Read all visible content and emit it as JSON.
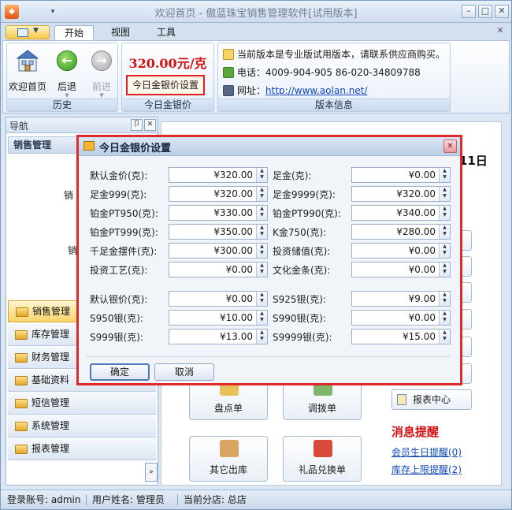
{
  "window": {
    "title": "欢迎首页 - 傲蓝珠宝销售管理软件[试用版本]",
    "minimize": "–",
    "maximize": "□",
    "close": "✕",
    "qa_arrow": "▾"
  },
  "ribbon_tabs": [
    {
      "label": "开始"
    },
    {
      "label": "视图"
    },
    {
      "label": "工具"
    }
  ],
  "ribbon": {
    "history_group": {
      "label": "历史",
      "buttons": [
        {
          "label": "欢迎首页"
        },
        {
          "label": "后退"
        },
        {
          "label": "前进"
        }
      ]
    },
    "price_group": {
      "label": "今日金银价",
      "price": "320.00元/克",
      "set_button": "今日金银价设置"
    },
    "info_group": {
      "label": "版本信息",
      "notice": "当前版本是专业版试用版本，请联系供应商购买。",
      "phone_label": "电话：",
      "phone": "4009-904-905  86-020-34809788",
      "site_label": "网址：",
      "site": "http://www.aolan.net/"
    }
  },
  "nav": {
    "title": "导航",
    "pin": "卩",
    "close": "✕",
    "section_title": "销售管理",
    "clip1": "销",
    "clip2": "销",
    "items": [
      {
        "label": "销售管理"
      },
      {
        "label": "库存管理"
      },
      {
        "label": "财务管理"
      },
      {
        "label": "基础资料"
      },
      {
        "label": "短信管理"
      },
      {
        "label": "系统管理"
      },
      {
        "label": "报表管理"
      }
    ],
    "expand": "»"
  },
  "main": {
    "date_fragment": "11日",
    "tiles": [
      {
        "label": "盘点单"
      },
      {
        "label": "调拨单"
      },
      {
        "label": "其它出库"
      },
      {
        "label": "礼品兑换单"
      }
    ],
    "report_button": "报表中心",
    "message_title": "消息提醒",
    "links": [
      {
        "label": "会员生日提醒(0)"
      },
      {
        "label": "库存上限提醒(2)"
      }
    ]
  },
  "status": {
    "account": "登录账号: admin",
    "username": "用户姓名: 管理员",
    "branch": "当前分店: 总店"
  },
  "dialog": {
    "title": "今日金银价设置",
    "fields_left": [
      {
        "label": "默认金价(克):",
        "value": "¥320.00"
      },
      {
        "label": "足金999(克):",
        "value": "¥320.00"
      },
      {
        "label": "铂金PT950(克):",
        "value": "¥330.00"
      },
      {
        "label": "铂金PT999(克):",
        "value": "¥350.00"
      },
      {
        "label": "千足金摆件(克):",
        "value": "¥300.00"
      },
      {
        "label": "投资工艺(克):",
        "value": "¥0.00"
      }
    ],
    "fields_right": [
      {
        "label": "足金(克):",
        "value": "¥0.00"
      },
      {
        "label": "足金9999(克):",
        "value": "¥320.00"
      },
      {
        "label": "铂金PT990(克):",
        "value": "¥340.00"
      },
      {
        "label": "K金750(克):",
        "value": "¥280.00"
      },
      {
        "label": "投资储值(克):",
        "value": "¥0.00"
      },
      {
        "label": "文化金条(克):",
        "value": "¥0.00"
      }
    ],
    "silver_left": [
      {
        "label": "默认银价(克):",
        "value": "¥0.00"
      },
      {
        "label": "S950银(克):",
        "value": "¥10.00"
      },
      {
        "label": "S999银(克):",
        "value": "¥13.00"
      }
    ],
    "silver_right": [
      {
        "label": "S925银(克):",
        "value": "¥9.00"
      },
      {
        "label": "S990银(克):",
        "value": "¥0.00"
      },
      {
        "label": "S9999银(克):",
        "value": "¥15.00"
      }
    ],
    "ok": "确定",
    "cancel": "取消",
    "close": "✕"
  }
}
